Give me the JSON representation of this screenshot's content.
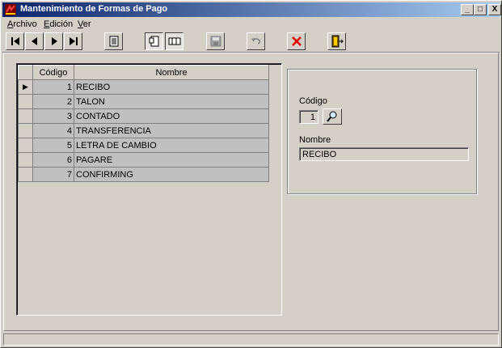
{
  "window": {
    "title": "Mantenimiento de Formas de Pago",
    "buttons": {
      "minimize": "_",
      "maximize": "□",
      "close": "X"
    }
  },
  "menu": [
    {
      "label": "Archivo",
      "mnemonic": "A",
      "rest": "rchivo"
    },
    {
      "label": "Edición",
      "mnemonic": "E",
      "rest": "dición"
    },
    {
      "label": "Ver",
      "mnemonic": "V",
      "rest": "er"
    }
  ],
  "toolbar": [
    {
      "name": "first-record-button",
      "icon": "first-icon"
    },
    {
      "name": "previous-record-button",
      "icon": "previous-icon"
    },
    {
      "name": "next-record-button",
      "icon": "next-icon"
    },
    {
      "name": "last-record-button",
      "icon": "last-icon"
    },
    {
      "name": "list-view-button",
      "icon": "list-icon"
    },
    {
      "name": "form-view-button",
      "icon": "form-icon",
      "pressed": true
    },
    {
      "name": "grid-view-button",
      "icon": "grid-icon",
      "pressed": true
    },
    {
      "name": "save-button",
      "icon": "save-icon"
    },
    {
      "name": "undo-button",
      "icon": "undo-icon"
    },
    {
      "name": "delete-button",
      "icon": "delete-icon"
    },
    {
      "name": "exit-button",
      "icon": "exit-door-icon"
    }
  ],
  "grid": {
    "headers": {
      "code": "Código",
      "name": "Nombre"
    },
    "current_row_indicator": "▶",
    "rows": [
      {
        "code": "1",
        "name": "RECIBO"
      },
      {
        "code": "2",
        "name": "TALON"
      },
      {
        "code": "3",
        "name": "CONTADO"
      },
      {
        "code": "4",
        "name": "TRANSFERENCIA"
      },
      {
        "code": "5",
        "name": "LETRA DE CAMBIO"
      },
      {
        "code": "6",
        "name": "PAGARE"
      },
      {
        "code": "7",
        "name": "CONFIRMING"
      }
    ]
  },
  "detail": {
    "code_label": "Código",
    "code_value": "1",
    "name_label": "Nombre",
    "name_value": "RECIBO"
  },
  "colors": {
    "title_start": "#0a246a",
    "title_end": "#a6caf0",
    "face": "#d4d0c8",
    "cell": "#c0c0c0",
    "delete_red": "#e00000"
  }
}
